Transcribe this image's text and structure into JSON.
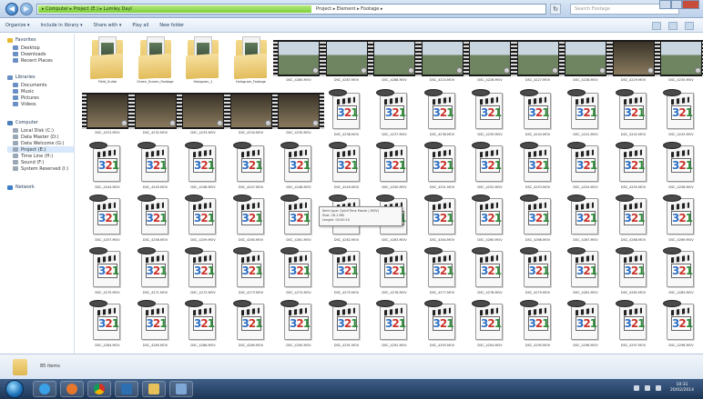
{
  "window": {
    "address_highlight": "▸ Computer ▸ Project (E:) ▸ Lumley Dayl",
    "address_rest": "Project ▸ Element ▸ Footage ▸",
    "search_placeholder": "Search Footage"
  },
  "toolbar": {
    "organize": "Organize ▾",
    "include": "Include in library ▾",
    "share": "Share with ▾",
    "play_all": "Play all",
    "new_folder": "New folder"
  },
  "navpane": {
    "favorites_header": "Favorites",
    "favorites": [
      "Desktop",
      "Downloads",
      "Recent Places"
    ],
    "libraries_header": "Libraries",
    "libraries": [
      "Documents",
      "Music",
      "Pictures",
      "Videos"
    ],
    "computer_header": "Computer",
    "drives": [
      "Local Disk (C:)",
      "Data Master (D:)",
      "Data Welcome (G:)",
      "Project (E:)",
      "Time Line (H:)",
      "Sound (F:)",
      "System Reserved (I:)"
    ],
    "network_header": "Network"
  },
  "folders": [
    {
      "label": "Field_Guide"
    },
    {
      "label": "Green_Screen_Footage"
    },
    {
      "label": "Hologram_1"
    },
    {
      "label": "Hologram_Footage"
    }
  ],
  "videos_row1": [
    "DSC_4280.MOV",
    "DSC_4287.MOV",
    "DSC_4288.MOV",
    "DSC_4224.MOV",
    "DSC_4226.MOV",
    "DSC_4227.MOV",
    "DSC_4228.MOV",
    "DSC_4229.MOV",
    "DSC_4230.MOV"
  ],
  "videos_row2": [
    "DSC_4231.MOV",
    "DSC_4232.MOV",
    "DSC_4233.MOV",
    "DSC_4234.MOV",
    "DSC_4235.MOV"
  ],
  "media_row2": [
    "DSC_4236.MOV",
    "DSC_4237.MOV",
    "DSC_4238.MOV",
    "DSC_4239.MOV",
    "DSC_4240.MOV",
    "DSC_4241.MOV",
    "DSC_4242.MOV",
    "DSC_4243.MOV"
  ],
  "media_row3": [
    "DSC_4244.MOV",
    "DSC_4245.MOV",
    "DSC_4246.MOV",
    "DSC_4247.MOV",
    "DSC_4248.MOV",
    "DSC_4249.MOV",
    "DSC_4250.MOV",
    "DSC_4251.MOV",
    "DSC_4252.MOV",
    "DSC_4253.MOV",
    "DSC_4254.MOV",
    "DSC_4255.MOV",
    "DSC_4256.MOV"
  ],
  "media_row4": [
    "DSC_4257.MOV",
    "DSC_4258.MOV",
    "DSC_4259.MOV",
    "DSC_4260.MOV",
    "DSC_4261.MOV",
    "DSC_4262.MOV",
    "DSC_4263.MOV",
    "DSC_4264.MOV",
    "DSC_4265.MOV",
    "DSC_4266.MOV",
    "DSC_4267.MOV",
    "DSC_4268.MOV",
    "DSC_4269.MOV"
  ],
  "media_row5": [
    "DSC_4270.MOV",
    "DSC_4271.MOV",
    "DSC_4272.MOV",
    "DSC_4273.MOV",
    "DSC_4274.MOV",
    "DSC_4275.MOV",
    "DSC_4276.MOV",
    "DSC_4277.MOV",
    "DSC_4278.MOV",
    "DSC_4279.MOV",
    "DSC_4281.MOV",
    "DSC_4282.MOV",
    "DSC_4283.MOV"
  ],
  "media_row6": [
    "DSC_4284.MOV",
    "DSC_4285.MOV",
    "DSC_4286.MOV",
    "DSC_4289.MOV",
    "DSC_4290.MOV",
    "DSC_4291.MOV",
    "DSC_4292.MOV",
    "DSC_4293.MOV",
    "DSC_4294.MOV",
    "DSC_4295.MOV",
    "DSC_4296.MOV",
    "DSC_4297.MOV",
    "DSC_4298.MOV"
  ],
  "media_number": "321",
  "tooltip": {
    "line1": "Item type: QuickTime Movie (.MOV)",
    "line2": "Size: 26.1 MB",
    "line3": "Length: 00:00:10"
  },
  "details": {
    "count": "85 items"
  },
  "taskbar": {
    "time": "10:31",
    "date": "20/02/2014"
  },
  "colors": {
    "video_frame_dark": "#3a3328",
    "video_frame_outdoor": "#6f8460",
    "sky": "#c9d6df"
  }
}
